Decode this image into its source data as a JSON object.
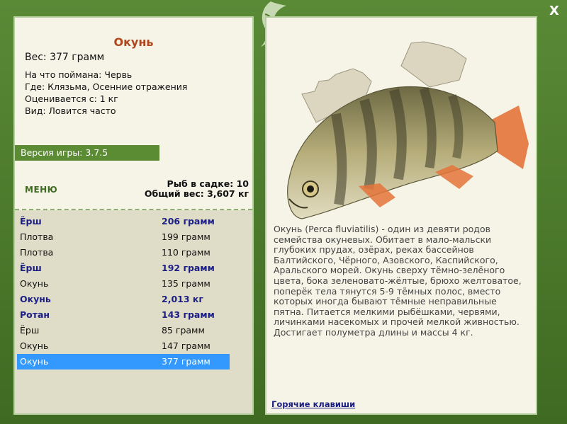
{
  "close_label": "X",
  "fish": {
    "title": "Окунь",
    "weight": "Вес: 377 грамм",
    "bait": "На что поймана: Червь",
    "location": "Где: Клязьма, Осенние отражения",
    "rated_from": "Оценивается с: 1 кг",
    "kind": "Вид: Ловится часто"
  },
  "version": "Версия игры: 3.7.5",
  "menu_label": "МЕНЮ",
  "stats": {
    "count": "Рыб в садке: 10",
    "total": "Общий вес: 3,607 кг"
  },
  "catch_list": [
    {
      "name": "Ёрш",
      "weight": "206 грамм",
      "style": "bold"
    },
    {
      "name": "Плотва",
      "weight": "199 грамм",
      "style": "normal"
    },
    {
      "name": "Плотва",
      "weight": "110 грамм",
      "style": "normal"
    },
    {
      "name": "Ёрш",
      "weight": "192 грамм",
      "style": "bold"
    },
    {
      "name": "Окунь",
      "weight": "135 грамм",
      "style": "normal"
    },
    {
      "name": "Окунь",
      "weight": "2,013 кг",
      "style": "bold"
    },
    {
      "name": "Ротан",
      "weight": "143 грамм",
      "style": "bold"
    },
    {
      "name": "Ёрш",
      "weight": "85 грамм",
      "style": "normal"
    },
    {
      "name": "Окунь",
      "weight": "147 грамм",
      "style": "normal"
    },
    {
      "name": "Окунь",
      "weight": "377 грамм",
      "style": "selected"
    }
  ],
  "description": "Окунь (Perca fluviatilis) - один из девяти родов семейства окуневых. Обитает в мало-мальски глубоких прудах, озёрах, реках бассейнов Балтийского, Чёрного, Азовского, Каспийского, Аральского морей. Окунь сверху тёмно-зелёного цвета, бока зеленовато-жёлтые, брюхо желтоватое, поперёк тела тянутся 5-9 тёмных полос, вместо которых иногда бывают тёмные неправильные пятна. Питается мелкими рыбёшками, червями, личинками насекомых и прочей мелкой живностью. Достигает полуметра длины и массы 4 кг.",
  "hotkeys_label": "Горячие клавиши"
}
